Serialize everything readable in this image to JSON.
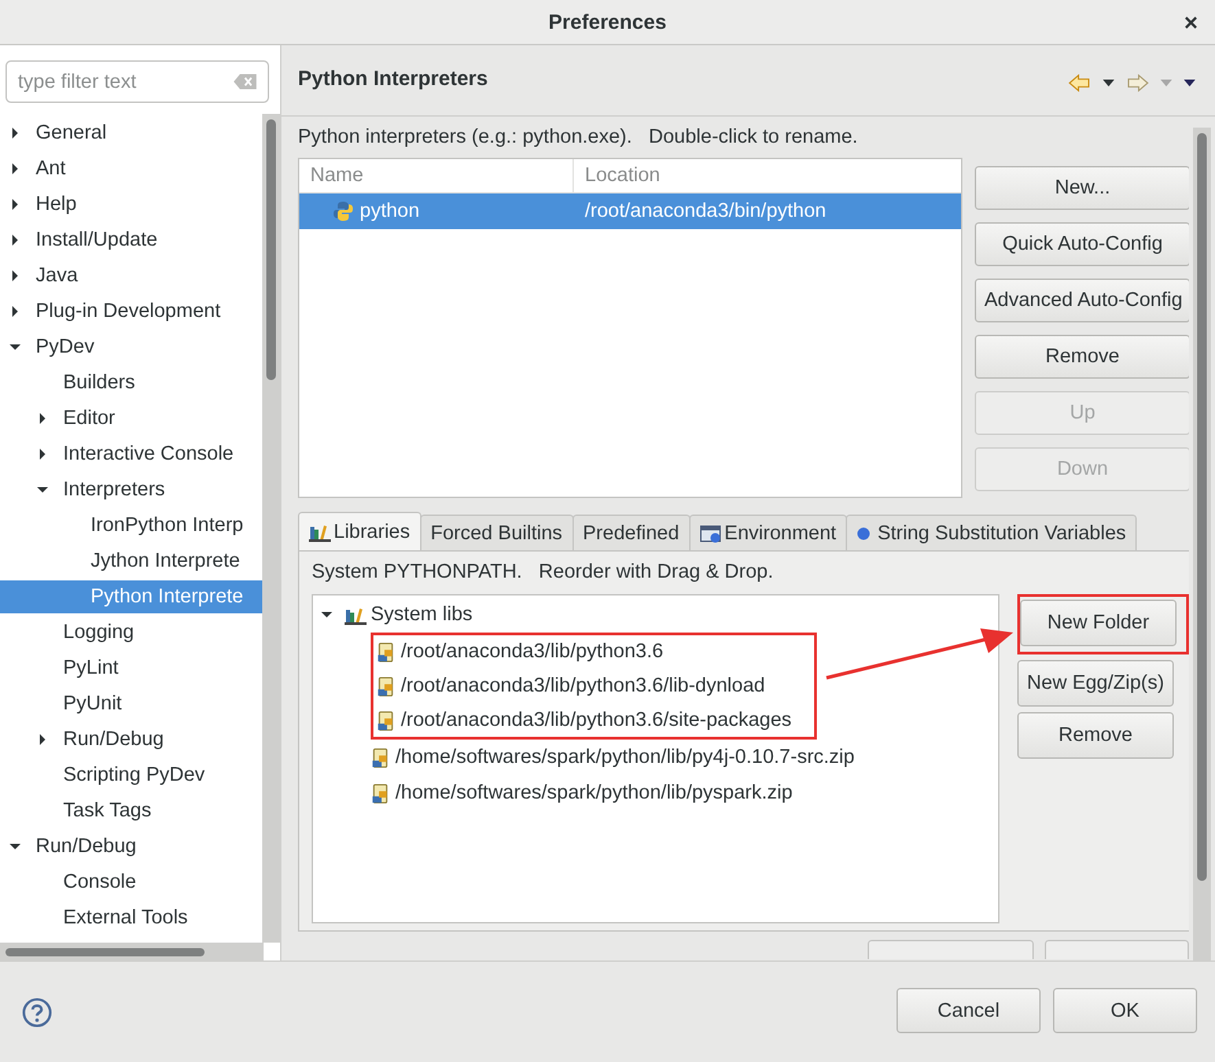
{
  "window": {
    "title": "Preferences"
  },
  "filter": {
    "placeholder": "type filter text"
  },
  "tree": [
    {
      "label": "General",
      "expanded": false,
      "selected": false
    },
    {
      "label": "Ant",
      "expanded": false,
      "selected": false
    },
    {
      "label": "Help",
      "expanded": false,
      "selected": false
    },
    {
      "label": "Install/Update",
      "expanded": false,
      "selected": false
    },
    {
      "label": "Java",
      "expanded": false,
      "selected": false
    },
    {
      "label": "Plug-in Development",
      "expanded": false,
      "selected": false
    },
    {
      "label": "PyDev",
      "expanded": true,
      "selected": false,
      "children": [
        {
          "label": "Builders",
          "selected": false
        },
        {
          "label": "Editor",
          "expanded": false,
          "selected": false
        },
        {
          "label": "Interactive Console",
          "expanded": false,
          "selected": false
        },
        {
          "label": "Interpreters",
          "expanded": true,
          "selected": false,
          "children": [
            {
              "label": "IronPython Interp",
              "selected": false
            },
            {
              "label": "Jython Interprete",
              "selected": false
            },
            {
              "label": "Python Interprete",
              "selected": true
            }
          ]
        },
        {
          "label": "Logging",
          "selected": false
        },
        {
          "label": "PyLint",
          "selected": false
        },
        {
          "label": "PyUnit",
          "selected": false
        },
        {
          "label": "Run/Debug",
          "expanded": false,
          "selected": false
        },
        {
          "label": "Scripting PyDev",
          "selected": false
        },
        {
          "label": "Task Tags",
          "selected": false
        }
      ]
    },
    {
      "label": "Run/Debug",
      "expanded": true,
      "selected": false,
      "children": [
        {
          "label": "Console",
          "selected": false
        },
        {
          "label": "External Tools",
          "selected": false
        }
      ]
    }
  ],
  "page": {
    "title": "Python Interpreters",
    "description": "Python interpreters (e.g.: python.exe).   Double-click to rename."
  },
  "interpreters": {
    "columns": [
      "Name",
      "Location"
    ],
    "rows": [
      {
        "name": "python",
        "location": "/root/anaconda3/bin/python",
        "selected": true
      }
    ]
  },
  "interpreter_buttons": [
    {
      "label": "New...",
      "disabled": false
    },
    {
      "label": "Quick Auto-Config",
      "disabled": false
    },
    {
      "label": "Advanced Auto-Config",
      "disabled": false
    },
    {
      "label": "Remove",
      "disabled": false
    },
    {
      "label": "Up",
      "disabled": true
    },
    {
      "label": "Down",
      "disabled": true
    }
  ],
  "tabs": [
    {
      "label": "Libraries",
      "kind": "books",
      "selected": true
    },
    {
      "label": "Forced Builtins",
      "kind": "plain",
      "selected": false
    },
    {
      "label": "Predefined",
      "kind": "plain",
      "selected": false
    },
    {
      "label": "Environment",
      "kind": "window",
      "selected": false
    },
    {
      "label": "String Substitution Variables",
      "kind": "dot",
      "selected": false
    }
  ],
  "libraries": {
    "description": "System PYTHONPATH.   Reorder with Drag & Drop.",
    "tree": [
      {
        "label": "System libs",
        "expanded": true,
        "children": [
          {
            "label": "/root/anaconda3/lib/python3.6",
            "highlighted": true
          },
          {
            "label": "/root/anaconda3/lib/python3.6/lib-dynload",
            "highlighted": true
          },
          {
            "label": "/root/anaconda3/lib/python3.6/site-packages",
            "highlighted": true
          },
          {
            "label": "/home/softwares/spark/python/lib/py4j-0.10.7-src.zip",
            "highlighted": false
          },
          {
            "label": "/home/softwares/spark/python/lib/pyspark.zip",
            "highlighted": false
          }
        ]
      }
    ],
    "buttons": [
      {
        "label": "New Folder",
        "highlighted": true
      },
      {
        "label": "New Egg/Zip(s)",
        "highlighted": false
      },
      {
        "label": "Remove",
        "highlighted": false
      }
    ]
  },
  "buttons": [
    "Cancel",
    "OK"
  ]
}
